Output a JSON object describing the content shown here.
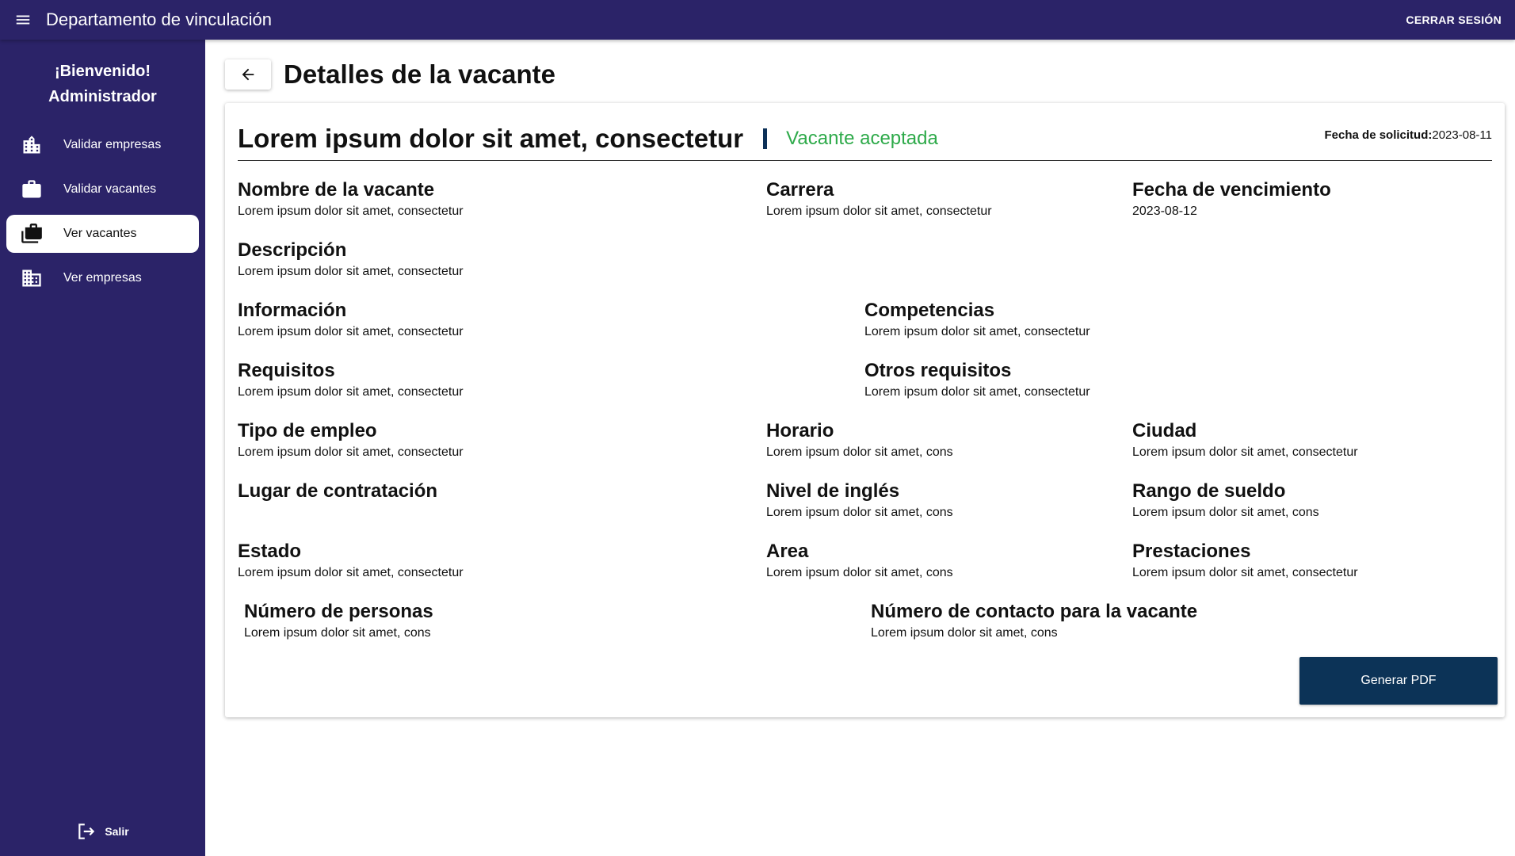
{
  "appbar": {
    "title": "Departamento de vinculación",
    "logout_label": "CERRAR SESIÓN"
  },
  "sidebar": {
    "welcome_line1": "¡Bienvenido!",
    "welcome_line2": "Administrador",
    "items": [
      {
        "label": "Validar empresas",
        "icon": "building-icon"
      },
      {
        "label": "Validar vacantes",
        "icon": "briefcase-icon"
      },
      {
        "label": "Ver vacantes",
        "icon": "briefcases-icon",
        "active": true
      },
      {
        "label": "Ver empresas",
        "icon": "business-icon"
      }
    ],
    "exit_label": "Salir"
  },
  "page": {
    "title": "Detalles de la vacante"
  },
  "vacancy": {
    "title": "Lorem ipsum dolor sit amet, consectetur",
    "status": "Vacante aceptada",
    "status_color": "#2eaa4a",
    "request_date_label": "Fecha de solicitud:",
    "request_date": "2023-08-11",
    "fields": {
      "nombre": {
        "label": "Nombre de la vacante",
        "value": "Lorem ipsum dolor sit amet, consectetur"
      },
      "carrera": {
        "label": "Carrera",
        "value": "Lorem ipsum dolor sit amet, consectetur"
      },
      "vencimiento": {
        "label": "Fecha de vencimiento",
        "value": "2023-08-12"
      },
      "descripcion": {
        "label": "Descripción",
        "value": "Lorem ipsum dolor sit amet, consectetur"
      },
      "informacion": {
        "label": "Información",
        "value": "Lorem ipsum dolor sit amet, consectetur"
      },
      "competencias": {
        "label": "Competencias",
        "value": "Lorem ipsum dolor sit amet, consectetur"
      },
      "requisitos": {
        "label": "Requisitos",
        "value": "Lorem ipsum dolor sit amet, consectetur"
      },
      "otros_requisitos": {
        "label": "Otros requisitos",
        "value": "Lorem ipsum dolor sit amet, consectetur"
      },
      "tipo_empleo": {
        "label": "Tipo de empleo",
        "value": "Lorem ipsum dolor sit amet, consectetur"
      },
      "horario": {
        "label": "Horario",
        "value": "Lorem ipsum dolor sit amet, cons"
      },
      "ciudad": {
        "label": "Ciudad",
        "value": "Lorem ipsum dolor sit amet, consectetur"
      },
      "lugar": {
        "label": "Lugar de contratación",
        "value": ""
      },
      "ingles": {
        "label": "Nivel de inglés",
        "value": "Lorem ipsum dolor sit amet, cons"
      },
      "sueldo": {
        "label": "Rango de sueldo",
        "value": "Lorem ipsum dolor sit amet, cons"
      },
      "estado": {
        "label": "Estado",
        "value": "Lorem ipsum dolor sit amet, consectetur"
      },
      "area": {
        "label": "Area",
        "value": "Lorem ipsum dolor sit amet, cons"
      },
      "prestaciones": {
        "label": "Prestaciones",
        "value": "Lorem ipsum dolor sit amet, consectetur"
      },
      "personas": {
        "label": "Número de personas",
        "value": "Lorem ipsum dolor sit amet, cons"
      },
      "contacto": {
        "label": "Número de contacto para la vacante",
        "value": "Lorem ipsum dolor sit amet, cons"
      }
    },
    "pdf_button": "Generar PDF"
  },
  "colors": {
    "primary": "#2b2368",
    "button": "#0c3357",
    "accent_bar": "#0d3158"
  }
}
